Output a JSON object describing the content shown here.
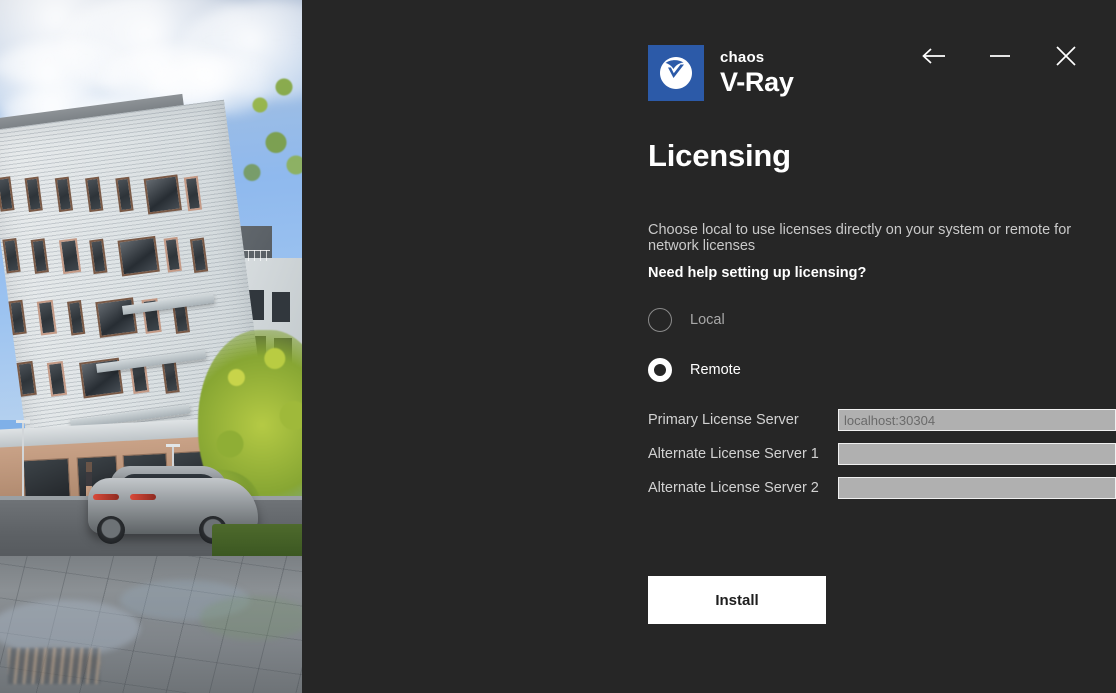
{
  "window": {
    "controls": [
      {
        "name": "back-button",
        "icon": "arrow-left-icon",
        "label": "Back"
      },
      {
        "name": "minimize-button",
        "icon": "minimize-icon",
        "label": "Minimize"
      },
      {
        "name": "close-button",
        "icon": "close-icon",
        "label": "Close"
      }
    ]
  },
  "brand": {
    "company": "chaos",
    "product": "V-Ray",
    "logo_icon": "vray-checkmark-logo-icon",
    "logo_bg_color": "#2c5aa8"
  },
  "page": {
    "title": "Licensing",
    "intro": "Choose local to use licenses directly on your system or remote for network licenses",
    "help_link": "Need help setting up licensing?"
  },
  "license_mode": {
    "selected": "remote",
    "options": [
      {
        "id": "local",
        "label": "Local",
        "selected": false
      },
      {
        "id": "remote",
        "label": "Remote",
        "selected": true
      }
    ]
  },
  "servers": {
    "fields": [
      {
        "id": "primary",
        "label": "Primary License Server",
        "value": "",
        "placeholder": "localhost:30304"
      },
      {
        "id": "alternate-1",
        "label": "Alternate License Server 1",
        "value": "",
        "placeholder": ""
      },
      {
        "id": "alternate-2",
        "label": "Alternate License Server 2",
        "value": "",
        "placeholder": ""
      }
    ]
  },
  "actions": {
    "install_label": "Install"
  },
  "hero": {
    "description": "Architectural exterior render of a white curved modern apartment building with a silver sports car on a wet plaza street",
    "sky_color": "#8fb9ee",
    "panel_bg": "#262626"
  }
}
